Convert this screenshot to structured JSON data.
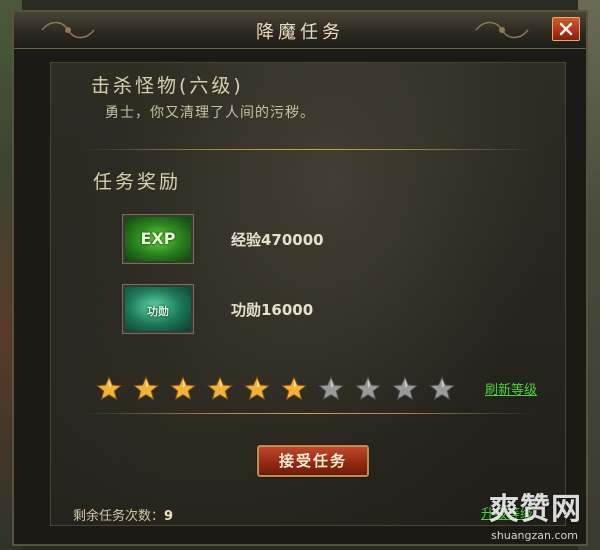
{
  "window": {
    "title": "降魔任务"
  },
  "quest": {
    "name": "击杀怪物(六级)",
    "description": "勇士，你又清理了人间的污秽。"
  },
  "rewards": {
    "heading": "任务奖励",
    "items": [
      {
        "icon": "exp-icon",
        "icon_text": "EXP",
        "label": "经验470000",
        "color": "#2e8a20"
      },
      {
        "icon": "merit-icon",
        "icon_text": "功勋",
        "label": "功勋16000",
        "color": "#1e7a5a"
      }
    ]
  },
  "rating": {
    "filled": 6,
    "total": 10,
    "refresh_label": "刷新等级",
    "filled_color": "#f0b23a",
    "empty_color": "#9a9a9a"
  },
  "accept_label": "接受任务",
  "remaining": {
    "label": "剩余任务次数：",
    "count": "9"
  },
  "bottom_link": "升级等级",
  "watermark": {
    "brand": "爽赞网",
    "url": "shuangzan.com"
  }
}
